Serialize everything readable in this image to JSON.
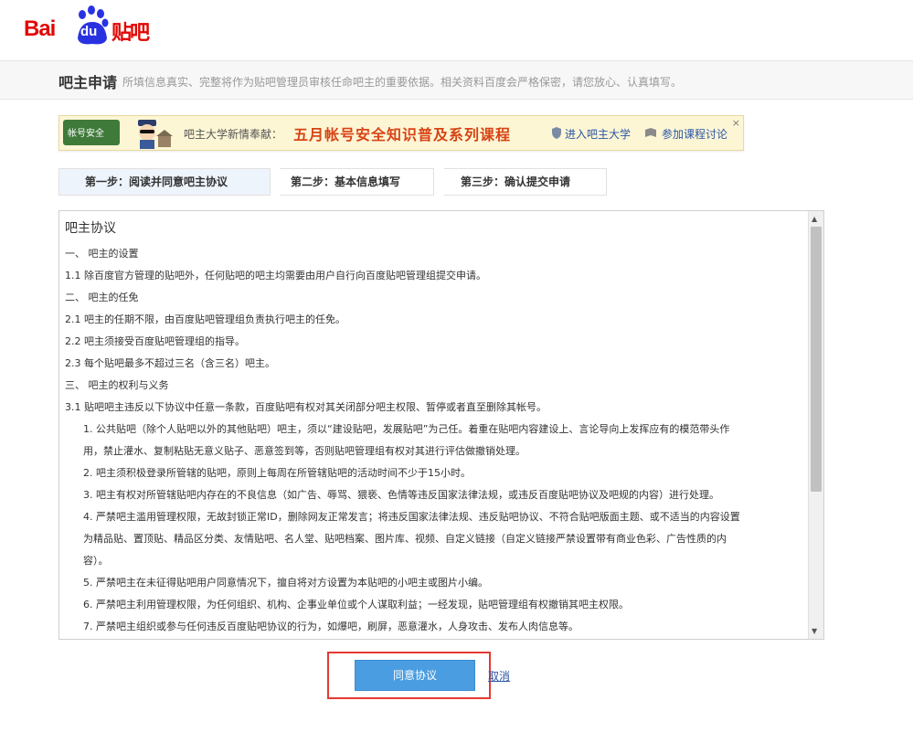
{
  "logo": {
    "bai": "Bai",
    "du": "du",
    "tieba": "贴吧"
  },
  "titlebar": {
    "title": "吧主申请",
    "subtitle": "所填信息真实、完整将作为贴吧管理员审核任命吧主的重要依据。相关资料百度会严格保密，请您放心、认真填写。"
  },
  "banner": {
    "tag": "帐号安全",
    "intro": "吧主大学新情奉献：",
    "headline": "五月帐号安全知识普及系列课程",
    "link1": "进入吧主大学",
    "link2": "参加课程讨论",
    "close": "×"
  },
  "steps": [
    {
      "label": "第一步：阅读并同意吧主协议"
    },
    {
      "label": "第二步：基本信息填写"
    },
    {
      "label": "第三步：确认提交申请"
    }
  ],
  "agreement": {
    "heading": "吧主协议",
    "lines": [
      "一、  吧主的设置",
      "1.1 除百度官方管理的贴吧外，任何贴吧的吧主均需要由用户自行向百度贴吧管理组提交申请。",
      "二、  吧主的任免",
      "2.1 吧主的任期不限，由百度贴吧管理组负责执行吧主的任免。",
      "2.2 吧主须接受百度贴吧管理组的指导。",
      "2.3 每个贴吧最多不超过三名（含三名）吧主。",
      "三、  吧主的权利与义务",
      "3.1 贴吧吧主违反以下协议中任意一条款，百度贴吧有权对其关闭部分吧主权限、暂停或者直至删除其帐号。",
      "1. 公共贴吧（除个人贴吧以外的其他贴吧）吧主，须以“建设贴吧，发展贴吧”为己任。着重在贴吧内容建设上、言论导向上发挥应有的模范带头作",
      "用，禁止灌水、复制粘贴无意义贴子、恶意签到等，否则贴吧管理组有权对其进行评估做撤销处理。",
      "2. 吧主须积极登录所管辖的贴吧，原则上每周在所管辖贴吧的活动时间不少于15小时。",
      "3. 吧主有权对所管辖贴吧内存在的不良信息（如广告、辱骂、猥亵、色情等违反国家法律法规，或违反百度贴吧协议及吧规的内容）进行处理。",
      "4. 严禁吧主滥用管理权限，无故封锁正常ID，删除网友正常发言；将违反国家法律法规、违反贴吧协议、不符合贴吧版面主题、或不适当的内容设置",
      "为精品贴、置顶贴、精品区分类、友情贴吧、名人堂、贴吧档案、图片库、视频、自定义链接（自定义链接严禁设置带有商业色彩、广告性质的内",
      "容）。",
      "5. 严禁吧主在未征得贴吧用户同意情况下，擅自将对方设置为本贴吧的小吧主或图片小编。",
      "6. 严禁吧主利用管理权限，为任何组织、机构、企事业单位或个人谋取利益；一经发现，贴吧管理组有权撤销其吧主权限。",
      "7. 严禁吧主组织或参与任何违反百度贴吧协议的行为，如爆吧，刷屏，恶意灌水，人身攻击、发布人肉信息等。"
    ]
  },
  "actions": {
    "agree": "同意协议",
    "cancel": "取消"
  }
}
